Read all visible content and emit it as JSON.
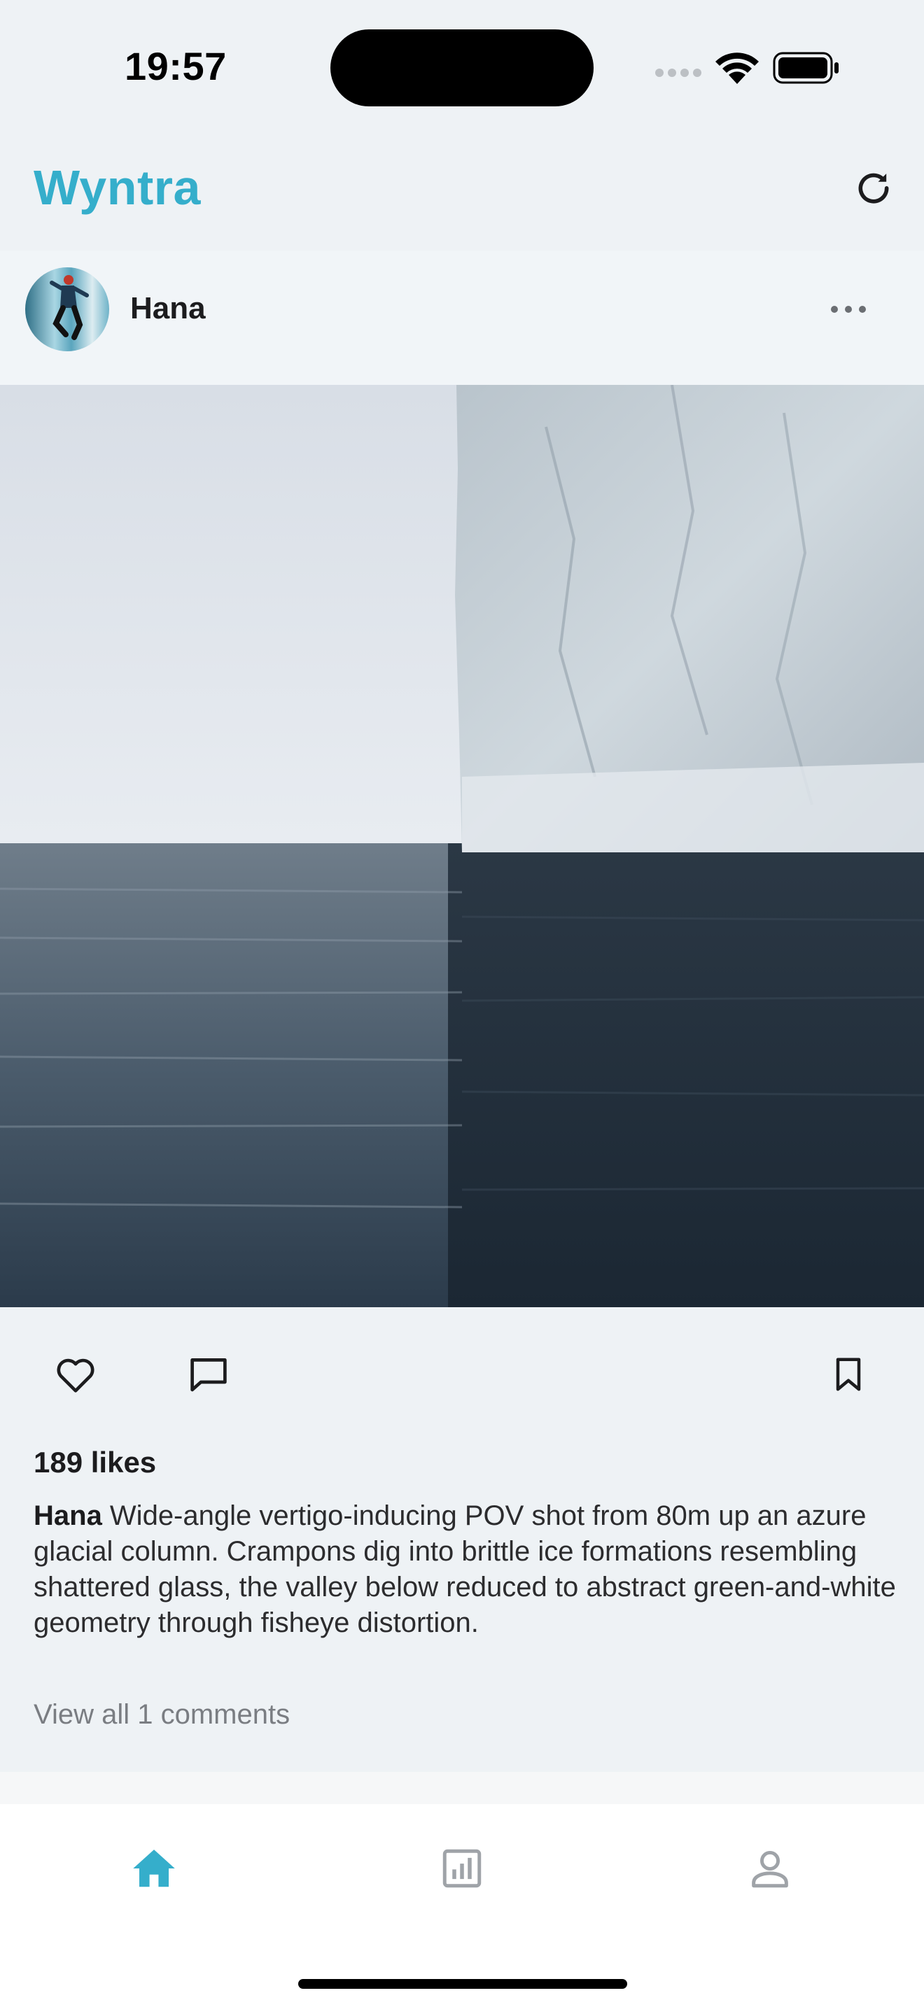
{
  "status_bar": {
    "time": "19:57"
  },
  "header": {
    "title": "Wyntra"
  },
  "post": {
    "username": "Hana",
    "likes_text": "189 likes",
    "caption_user": "Hana",
    "caption_text": " Wide-angle vertigo-inducing POV shot from 80m up an azure glacial column. Crampons dig into brittle ice formations resembling shattered glass, the valley below reduced to abstract green-and-white geometry through fisheye distortion.",
    "view_comments": "View all 1 comments"
  },
  "icons": {
    "refresh": "refresh-icon",
    "more": "more-horizontal-icon",
    "like": "heart-icon",
    "comment": "comment-icon",
    "save": "bookmark-icon",
    "home": "home-icon",
    "stats": "bar-chart-icon",
    "profile": "person-icon"
  },
  "tabs": {
    "active": "home"
  },
  "colors": {
    "accent": "#35AECB",
    "background": "#EEF2F5",
    "inactive_icon": "#9FA3A8"
  }
}
